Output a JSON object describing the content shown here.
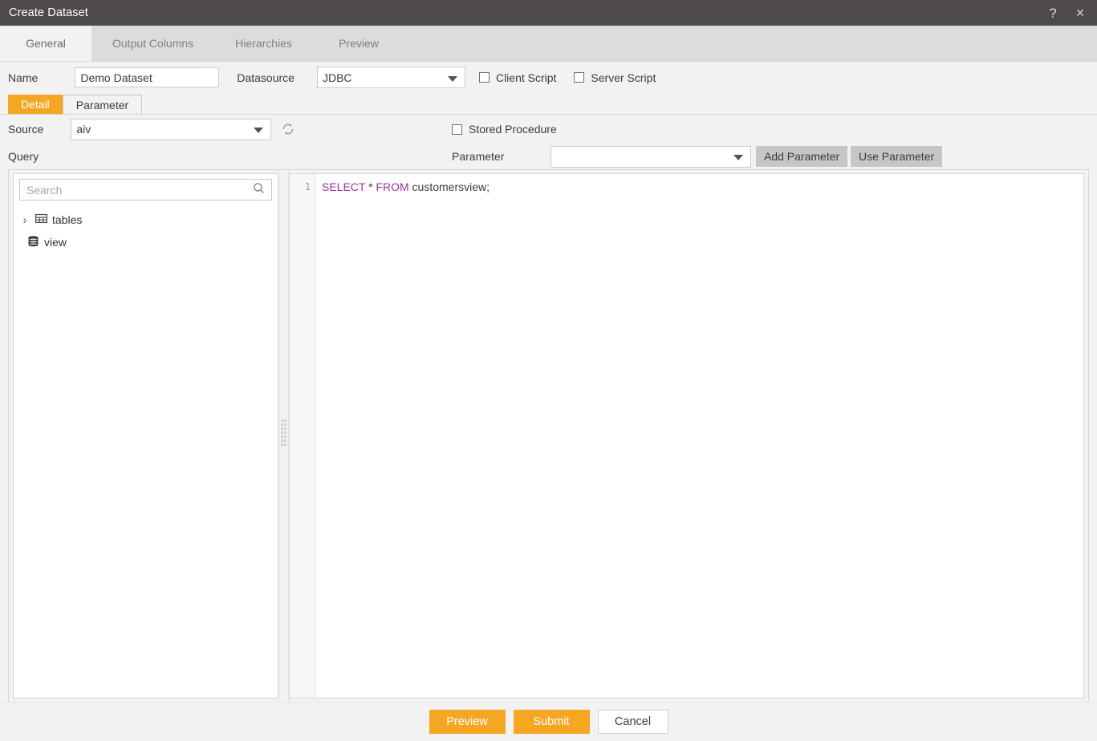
{
  "window": {
    "title": "Create Dataset",
    "help_icon": "?",
    "close_icon": "×"
  },
  "tabs": [
    {
      "label": "General",
      "active": true
    },
    {
      "label": "Output Columns",
      "active": false
    },
    {
      "label": "Hierarchies",
      "active": false
    },
    {
      "label": "Preview",
      "active": false
    }
  ],
  "general": {
    "name_label": "Name",
    "name_value": "Demo Dataset",
    "datasource_label": "Datasource",
    "datasource_value": "JDBC",
    "client_script_label": "Client Script",
    "client_script_checked": false,
    "server_script_label": "Server Script",
    "server_script_checked": false
  },
  "subtabs": [
    {
      "label": "Detail",
      "active": true
    },
    {
      "label": "Parameter",
      "active": false
    }
  ],
  "detail": {
    "source_label": "Source",
    "source_value": "aiv",
    "refresh_icon": "refresh-icon",
    "stored_procedure_label": "Stored Procedure",
    "stored_procedure_checked": false,
    "query_label": "Query",
    "parameter_label": "Parameter",
    "parameter_value": "",
    "add_parameter_label": "Add Parameter",
    "use_parameter_label": "Use Parameter"
  },
  "explorer": {
    "search_placeholder": "Search",
    "search_value": "",
    "search_icon": "search-icon",
    "tree": [
      {
        "label": "tables",
        "icon": "table-grid-icon",
        "expandable": true,
        "chevron": "›"
      },
      {
        "label": "view",
        "icon": "database-stack-icon",
        "expandable": false,
        "chevron": ""
      }
    ]
  },
  "editor": {
    "line_numbers": [
      "1"
    ],
    "sql_tokens": [
      {
        "text": "SELECT",
        "type": "keyword"
      },
      {
        "text": " ",
        "type": "plain"
      },
      {
        "text": "*",
        "type": "operator"
      },
      {
        "text": " ",
        "type": "plain"
      },
      {
        "text": "FROM",
        "type": "keyword"
      },
      {
        "text": " customersview;",
        "type": "plain"
      }
    ],
    "sql_text": "SELECT * FROM customersview;"
  },
  "footer": {
    "preview_label": "Preview",
    "submit_label": "Submit",
    "cancel_label": "Cancel"
  },
  "colors": {
    "titlebar": "#4d4a49",
    "accent": "#f5a623",
    "tab_inactive": "#dcdcdc",
    "tab_active": "#f2f2f2",
    "keyword": "#9b30a0",
    "button_gray": "#c6c6c6"
  }
}
